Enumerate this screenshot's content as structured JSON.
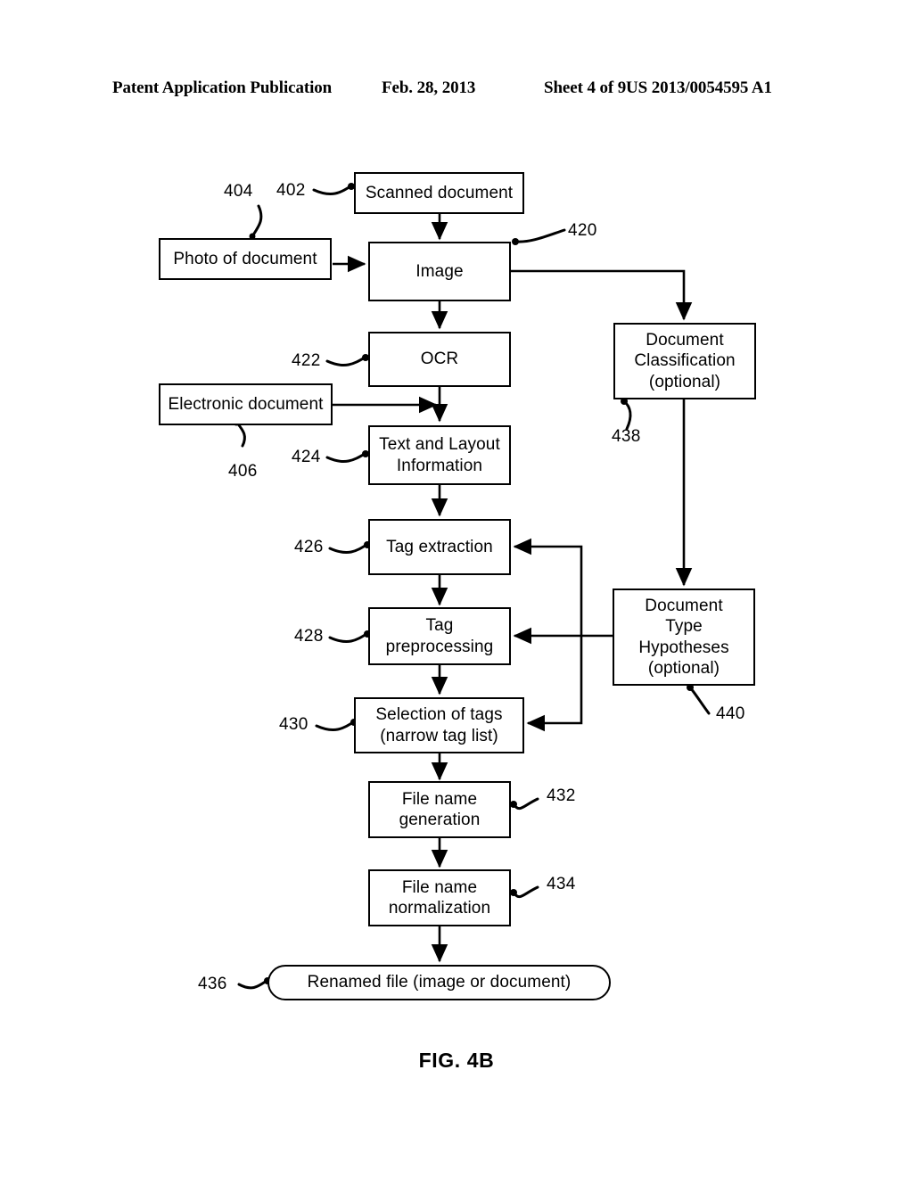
{
  "header": {
    "title": "Patent Application Publication",
    "date": "Feb. 28, 2013",
    "sheet": "Sheet 4 of 9",
    "publication_number": "US 2013/0054595 A1"
  },
  "figure": {
    "caption": "FIG. 4B",
    "type": "flowchart"
  },
  "nodes": [
    {
      "id": "scanned_document",
      "label": "Scanned document",
      "ref": "402",
      "shape": "rect"
    },
    {
      "id": "photo_of_document",
      "label": "Photo of document",
      "ref": "404",
      "shape": "rect"
    },
    {
      "id": "electronic_document",
      "label": "Electronic document",
      "ref": "406",
      "shape": "rect"
    },
    {
      "id": "image",
      "label": "Image",
      "ref": "420",
      "shape": "rect"
    },
    {
      "id": "ocr",
      "label": "OCR",
      "ref": "422",
      "shape": "rect"
    },
    {
      "id": "text_and_layout",
      "label": "Text and Layout\nInformation",
      "ref": "424",
      "shape": "rect"
    },
    {
      "id": "tag_extraction",
      "label": "Tag extraction",
      "ref": "426",
      "shape": "rect"
    },
    {
      "id": "tag_preprocessing",
      "label": "Tag\npreprocessing",
      "ref": "428",
      "shape": "rect"
    },
    {
      "id": "selection_of_tags",
      "label": "Selection of tags\n(narrow tag list)",
      "ref": "430",
      "shape": "rect"
    },
    {
      "id": "file_name_generation",
      "label": "File name\ngeneration",
      "ref": "432",
      "shape": "rect"
    },
    {
      "id": "file_name_normalization",
      "label": "File name\nnormalization",
      "ref": "434",
      "shape": "rect"
    },
    {
      "id": "renamed_file",
      "label": "Renamed file (image or document)",
      "ref": "436",
      "shape": "rounded"
    },
    {
      "id": "document_classification",
      "label": "Document\nClassification\n(optional)",
      "ref": "438",
      "shape": "rect"
    },
    {
      "id": "document_type_hypotheses",
      "label": "Document\nType\nHypotheses\n(optional)",
      "ref": "440",
      "shape": "rect"
    }
  ],
  "refs": {
    "n402": "402",
    "n404": "404",
    "n406": "406",
    "n420": "420",
    "n422": "422",
    "n424": "424",
    "n426": "426",
    "n428": "428",
    "n430": "430",
    "n432": "432",
    "n434": "434",
    "n436": "436",
    "n438": "438",
    "n440": "440"
  }
}
